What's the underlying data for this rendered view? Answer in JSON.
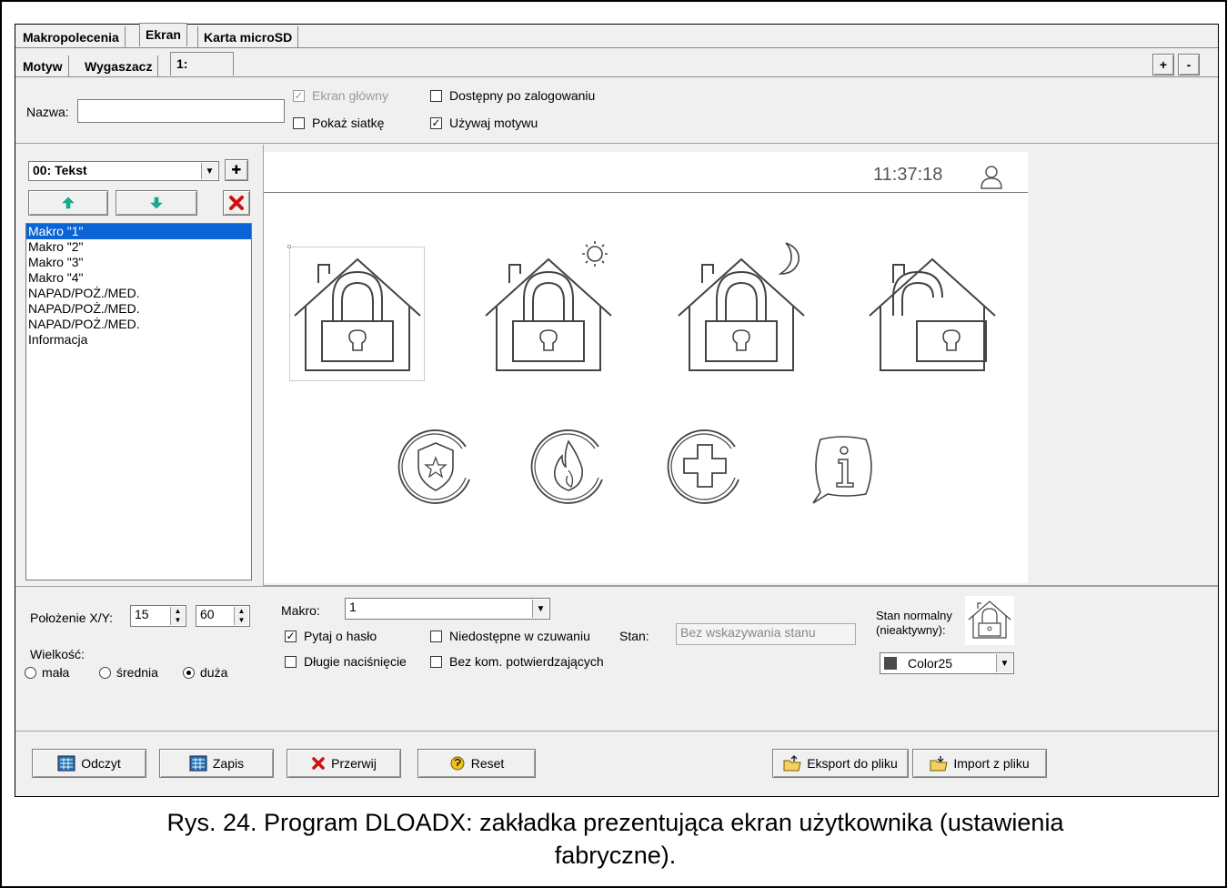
{
  "tabs_top": [
    "Makropolecenia",
    "Ekran",
    "Karta microSD"
  ],
  "tabs_sub": [
    "Motyw",
    "Wygaszacz",
    "1:"
  ],
  "plus_label": "+",
  "minus_label": "-",
  "name_label": "Nazwa:",
  "name_value": "",
  "checks_top": {
    "main_screen": "Ekran główny",
    "after_login": "Dostępny po zalogowaniu",
    "show_grid": "Pokaż siatkę",
    "use_theme": "Używaj motywu"
  },
  "element_select": "00: Tekst",
  "add_symbol": "✚",
  "list_items": [
    "Makro \"1\"",
    "Makro \"2\"",
    "Makro \"3\"",
    "Makro \"4\"",
    "NAPAD/POŻ./MED.",
    "NAPAD/POŻ./MED.",
    "NAPAD/POŻ./MED.",
    "Informacja"
  ],
  "preview": {
    "time": "11:37:18"
  },
  "position_label": "Położenie X/Y:",
  "pos_x": "15",
  "pos_y": "60",
  "size_label": "Wielkość:",
  "size_options": [
    "mała",
    "średnia",
    "duża"
  ],
  "macro_label": "Makro:",
  "macro_value": "1",
  "opt_ask_password": "Pytaj o hasło",
  "opt_long_press": "Długie naciśnięcie",
  "opt_unavailable_armed": "Niedostępne w czuwaniu",
  "opt_no_confirm": "Bez kom. potwierdzających",
  "state_label": "Stan:",
  "state_value": "Bez wskazywania stanu",
  "normal_state_label_1": "Stan normalny",
  "normal_state_label_2": "(nieaktywny):",
  "color_value": "Color25",
  "bottom_buttons": {
    "read": "Odczyt",
    "write": "Zapis",
    "abort": "Przerwij",
    "reset": "Reset",
    "export": "Eksport do pliku",
    "import": "Import z pliku"
  },
  "caption_line1": "Rys. 24. Program DLOADX: zakładka prezentująca ekran użytkownika (ustawienia",
  "caption_line2": "fabryczne)."
}
